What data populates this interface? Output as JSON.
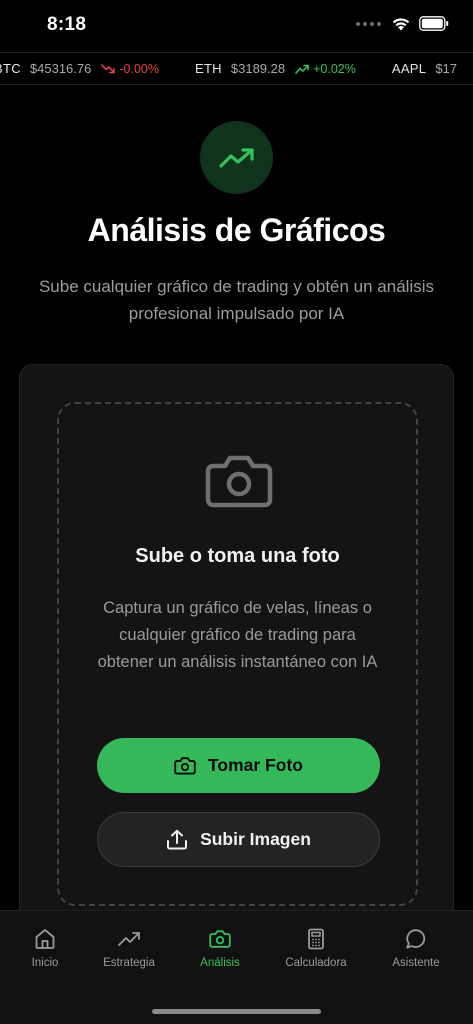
{
  "status_bar": {
    "time": "8:18",
    "icons": [
      "signal-dots-icon",
      "wifi-icon",
      "battery-icon"
    ]
  },
  "ticker": [
    {
      "symbol": "BTC",
      "price": "$45316.76",
      "change": "-0.00%",
      "direction": "down"
    },
    {
      "symbol": "ETH",
      "price": "$3189.28",
      "change": "+0.02%",
      "direction": "up"
    },
    {
      "symbol": "AAPL",
      "price": "$17"
    }
  ],
  "hero": {
    "icon": "trending-up-icon",
    "title": "Análisis de Gráficos",
    "subtitle": "Sube cualquier gráfico de trading y obtén un análisis profesional impulsado por IA"
  },
  "upload": {
    "icon": "camera-icon",
    "title": "Sube o toma una foto",
    "text": "Captura un gráfico de velas, líneas o cualquier gráfico de trading para obtener un análisis instantáneo con IA",
    "take_photo_label": "Tomar Foto",
    "upload_image_label": "Subir Imagen"
  },
  "tabs": [
    {
      "label": "Inicio",
      "icon": "home-icon",
      "active": false
    },
    {
      "label": "Estrategia",
      "icon": "trending-up-icon",
      "active": false
    },
    {
      "label": "Análisis",
      "icon": "camera-icon",
      "active": true
    },
    {
      "label": "Calculadora",
      "icon": "calculator-icon",
      "active": false
    },
    {
      "label": "Asistente",
      "icon": "chat-bubble-icon",
      "active": false
    }
  ],
  "colors": {
    "accent": "#35c15a",
    "negative": "#e0443e",
    "background": "#000000",
    "card": "#141414"
  }
}
